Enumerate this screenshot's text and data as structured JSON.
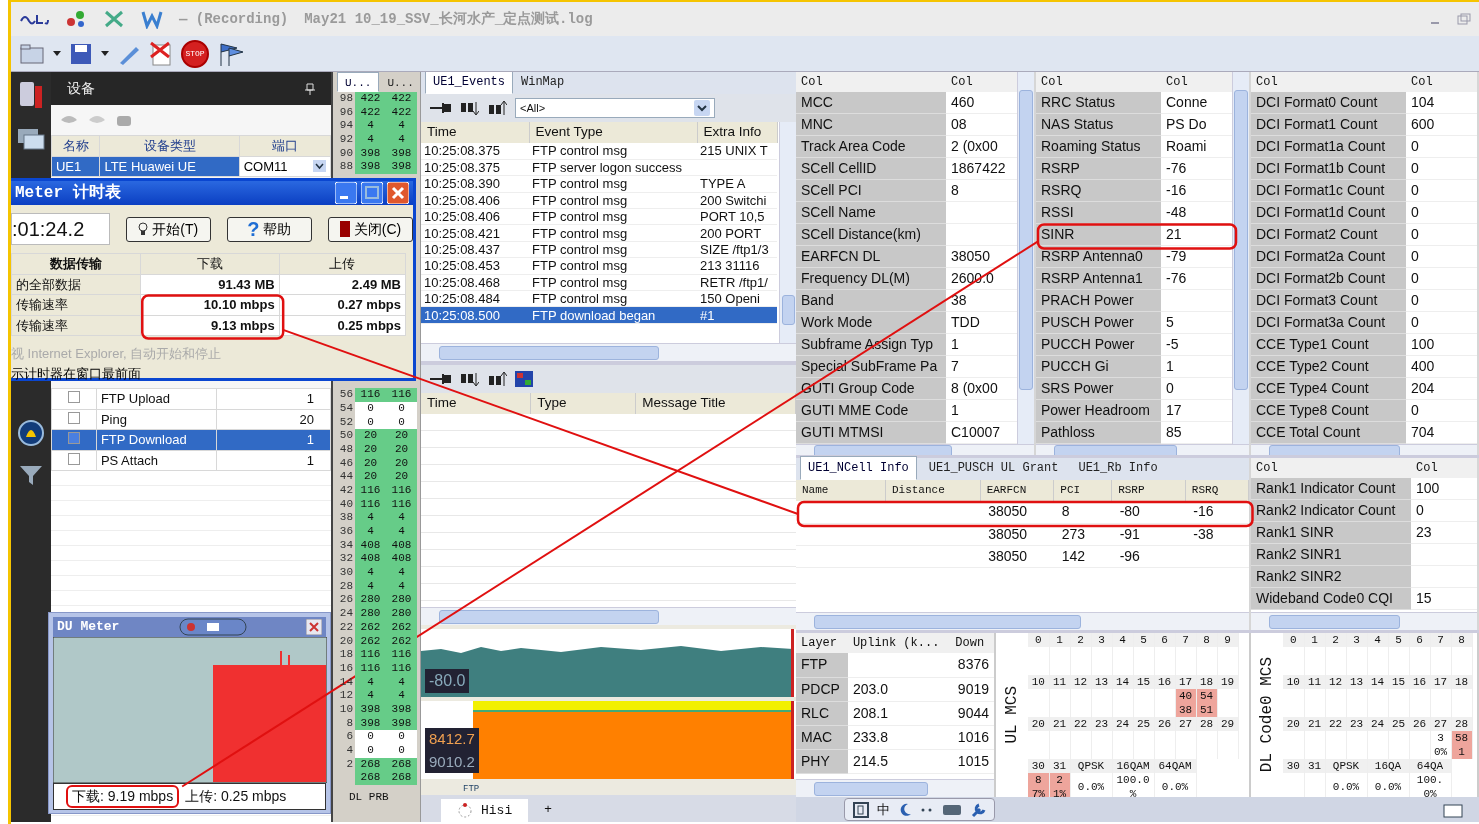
{
  "window": {
    "mode": "— (Recording)",
    "file": "May21 10_19_SSV_长河水产_定点测试.log"
  },
  "toolbar": {
    "stop_label": "STOP"
  },
  "device_panel": {
    "title": "设备",
    "columns": [
      "名称",
      "设备类型",
      "端口"
    ],
    "devices": [
      {
        "name": "UE1",
        "type": "LTE Huawei UE",
        "port": "COM11",
        "selected": true
      }
    ],
    "tasks": [
      {
        "name": "FTP Upload",
        "count": "1",
        "checked": false,
        "selected": false
      },
      {
        "name": "Ping",
        "count": "20",
        "checked": false,
        "selected": false
      },
      {
        "name": "FTP Download",
        "count": "1",
        "checked": false,
        "selected": true
      },
      {
        "name": "PS Attach",
        "count": "1",
        "checked": false,
        "selected": false
      }
    ]
  },
  "du_timer": {
    "title": "Meter 计时表",
    "elapsed": ":01:24.2",
    "buttons": [
      {
        "label": "开始(T)",
        "kind": "start"
      },
      {
        "label": "帮助",
        "kind": "help",
        "icon_text": "?"
      },
      {
        "label": "关闭(C)",
        "kind": "close"
      }
    ],
    "columns": [
      "数据传输",
      "下载",
      "上传"
    ],
    "rows": [
      {
        "label": "的全部数据",
        "download": "91.43 MB",
        "upload": "2.49 MB"
      },
      {
        "label": "传输速率",
        "download": "10.10 mbps",
        "upload": "0.27 mbps"
      },
      {
        "label": "传输速率",
        "download": "9.13 mbps",
        "upload": "0.25 mbps"
      }
    ],
    "options": [
      {
        "label": "视 Internet Explorer, 自动开始和停止",
        "disabled": true
      },
      {
        "label": "示计时器在窗口最前面",
        "disabled": false
      }
    ]
  },
  "du_meter": {
    "title": "DU Meter",
    "download": "下载: 9.19 mbps",
    "upload": "上传: 0.25 mbps"
  },
  "prb": {
    "columns": [
      "U...",
      "U..."
    ],
    "footer": "DL PRB",
    "top_rows": [
      {
        "label": "98",
        "values": [
          "422",
          "422"
        ],
        "shaded": true
      },
      {
        "label": "96",
        "values": [
          "422",
          "422"
        ],
        "shaded": true
      },
      {
        "label": "94",
        "values": [
          "4",
          "4"
        ],
        "shaded": true
      },
      {
        "label": "92",
        "values": [
          "4",
          "4"
        ],
        "shaded": true
      },
      {
        "label": "90",
        "values": [
          "398",
          "398"
        ],
        "shaded": true
      },
      {
        "label": "88",
        "values": [
          "398",
          "398"
        ],
        "shaded": true
      }
    ],
    "bottom_rows": [
      {
        "label": "56",
        "values": [
          "116",
          "116"
        ],
        "shaded": true
      },
      {
        "label": "54",
        "values": [
          "0",
          "0"
        ],
        "shaded": false
      },
      {
        "label": "52",
        "values": [
          "0",
          "0"
        ],
        "shaded": false
      },
      {
        "label": "50",
        "values": [
          "20",
          "20"
        ],
        "shaded": true
      },
      {
        "label": "48",
        "values": [
          "20",
          "20"
        ],
        "shaded": true
      },
      {
        "label": "46",
        "values": [
          "20",
          "20"
        ],
        "shaded": true
      },
      {
        "label": "44",
        "values": [
          "20",
          "20"
        ],
        "shaded": true
      },
      {
        "label": "42",
        "values": [
          "116",
          "116"
        ],
        "shaded": true
      },
      {
        "label": "40",
        "values": [
          "116",
          "116"
        ],
        "shaded": true
      },
      {
        "label": "38",
        "values": [
          "4",
          "4"
        ],
        "shaded": true
      },
      {
        "label": "36",
        "values": [
          "4",
          "4"
        ],
        "shaded": true
      },
      {
        "label": "34",
        "values": [
          "408",
          "408"
        ],
        "shaded": true
      },
      {
        "label": "32",
        "values": [
          "408",
          "408"
        ],
        "shaded": true
      },
      {
        "label": "30",
        "values": [
          "4",
          "4"
        ],
        "shaded": true
      },
      {
        "label": "28",
        "values": [
          "4",
          "4"
        ],
        "shaded": true
      },
      {
        "label": "26",
        "values": [
          "280",
          "280"
        ],
        "shaded": true
      },
      {
        "label": "24",
        "values": [
          "280",
          "280"
        ],
        "shaded": true
      },
      {
        "label": "22",
        "values": [
          "262",
          "262"
        ],
        "shaded": true
      },
      {
        "label": "20",
        "values": [
          "262",
          "262"
        ],
        "shaded": true
      },
      {
        "label": "18",
        "values": [
          "116",
          "116"
        ],
        "shaded": true
      },
      {
        "label": "16",
        "values": [
          "116",
          "116"
        ],
        "shaded": true
      },
      {
        "label": "14",
        "values": [
          "4",
          "4"
        ],
        "shaded": true
      },
      {
        "label": "12",
        "values": [
          "4",
          "4"
        ],
        "shaded": true
      },
      {
        "label": "10",
        "values": [
          "398",
          "398"
        ],
        "shaded": true
      },
      {
        "label": "8",
        "values": [
          "398",
          "398"
        ],
        "shaded": true
      },
      {
        "label": "6",
        "values": [
          "0",
          "0"
        ],
        "shaded": false
      },
      {
        "label": "4",
        "values": [
          "0",
          "0"
        ],
        "shaded": false
      },
      {
        "label": "2",
        "values": [
          "268",
          "268"
        ],
        "shaded": true
      },
      {
        "values": [
          "268",
          "268"
        ],
        "shaded": true
      }
    ]
  },
  "events": {
    "tabs": [
      {
        "label": "UE1_Events",
        "selected": true
      },
      {
        "label": "WinMap",
        "selected": false
      }
    ],
    "filter": "<All>",
    "columns": [
      "Time",
      "Event Type",
      "Extra Info"
    ],
    "rows": [
      {
        "cells": [
          "10:25:08.375",
          "FTP control msg",
          "215 UNIX T"
        ],
        "selected": false
      },
      {
        "cells": [
          "10:25:08.375",
          "FTP server logon success"
        ],
        "selected": false
      },
      {
        "cells": [
          "10:25:08.390",
          "FTP control msg",
          "TYPE A"
        ],
        "selected": false
      },
      {
        "cells": [
          "10:25:08.406",
          "FTP control msg",
          "200 Switchi"
        ],
        "selected": false
      },
      {
        "cells": [
          "10:25:08.406",
          "FTP control msg",
          "PORT 10,5"
        ],
        "selected": false
      },
      {
        "cells": [
          "10:25:08.421",
          "FTP control msg",
          "200 PORT"
        ],
        "selected": false
      },
      {
        "cells": [
          "10:25:08.437",
          "FTP control msg",
          "SIZE /ftp1/3"
        ],
        "selected": false
      },
      {
        "cells": [
          "10:25:08.453",
          "FTP control msg",
          "213 31116"
        ],
        "selected": false
      },
      {
        "cells": [
          "10:25:08.468",
          "FTP control msg",
          "RETR /ftp1/"
        ],
        "selected": false
      },
      {
        "cells": [
          "10:25:08.484",
          "FTP control msg",
          "150 Openi"
        ],
        "selected": false
      },
      {
        "cells": [
          "10:25:08.500",
          "FTP download began",
          "#1"
        ],
        "selected": true
      }
    ]
  },
  "messages": {
    "columns": [
      "Time",
      "Type",
      "Message Title"
    ]
  },
  "strip_charts": {
    "rsrp_reading": "-80.0",
    "throughput_readings": [
      "8412.7",
      "9010.2"
    ],
    "marker": "FTP"
  },
  "bottom_tabs": [
    {
      "label": "Hisi",
      "selected": true
    }
  ],
  "add_tab": "+",
  "info_tables": [
    {
      "columns": [
        "Col",
        "Col"
      ],
      "rows": [
        [
          "MCC",
          "460"
        ],
        [
          "MNC",
          "08"
        ],
        [
          "Track Area Code",
          "2 (0x00"
        ],
        [
          "SCell CellID",
          "1867422"
        ],
        [
          "SCell PCI",
          "8"
        ],
        [
          "SCell Name",
          ""
        ],
        [
          "SCell Distance(km)",
          ""
        ],
        [
          "EARFCN DL",
          "38050"
        ],
        [
          "Frequency DL(M)",
          "2600.0"
        ],
        [
          "Band",
          "38"
        ],
        [
          "Work Mode",
          "TDD"
        ],
        [
          "Subframe Assign Typ",
          "1"
        ],
        [
          "Special SubFrame Pa",
          "7"
        ],
        [
          "GUTI Group Code",
          "8 (0x00"
        ],
        [
          "GUTI MME Code",
          "1"
        ],
        [
          "GUTI MTMSI",
          "C10007"
        ]
      ]
    },
    {
      "columns": [
        "Col",
        "Col"
      ],
      "rows": [
        [
          "RRC Status",
          "Conne"
        ],
        [
          "NAS Status",
          "PS Do"
        ],
        [
          "Roaming Status",
          "Roami"
        ],
        [
          "RSRP",
          "-76"
        ],
        [
          "RSRQ",
          "-16"
        ],
        [
          "RSSI",
          "-48"
        ],
        [
          "SINR",
          "21"
        ],
        [
          "RSRP Antenna0",
          "-79"
        ],
        [
          "RSRP Antenna1",
          "-76"
        ],
        [
          "PRACH Power",
          ""
        ],
        [
          "PUSCH Power",
          "5"
        ],
        [
          "PUCCH Power",
          "-5"
        ],
        [
          "PUCCH Gi",
          "1"
        ],
        [
          "SRS Power",
          "0"
        ],
        [
          "Power Headroom",
          "17"
        ],
        [
          "Pathloss",
          "85"
        ]
      ]
    },
    {
      "columns": [
        "Col",
        "Col"
      ],
      "rows": [
        [
          "DCI Format0 Count",
          "104"
        ],
        [
          "DCI Format1 Count",
          "600"
        ],
        [
          "DCI Format1a Count",
          "0"
        ],
        [
          "DCI Format1b Count",
          "0"
        ],
        [
          "DCI Format1c Count",
          "0"
        ],
        [
          "DCI Format1d Count",
          "0"
        ],
        [
          "DCI Format2 Count",
          "0"
        ],
        [
          "DCI Format2a Count",
          "0"
        ],
        [
          "DCI Format2b Count",
          "0"
        ],
        [
          "DCI Format3 Count",
          "0"
        ],
        [
          "DCI Format3a Count",
          "0"
        ],
        [
          "CCE Type1 Count",
          "100"
        ],
        [
          "CCE Type2 Count",
          "400"
        ],
        [
          "CCE Type4 Count",
          "204"
        ],
        [
          "CCE Type8 Count",
          "0"
        ],
        [
          "CCE Total Count",
          "704"
        ]
      ]
    }
  ],
  "ncell": {
    "tabs": [
      {
        "label": "UE1_NCell Info",
        "selected": true
      },
      {
        "label": "UE1_PUSCH UL Grant",
        "selected": false
      },
      {
        "label": "UE1_Rb Info",
        "selected": false
      }
    ],
    "columns": [
      "Name",
      "Distance",
      "EARFCN",
      "PCI",
      "RSRP",
      "RSRQ"
    ],
    "rows": [
      [
        "",
        "",
        "38050",
        "8",
        "-80",
        "-16"
      ],
      [
        "",
        "",
        "38050",
        "273",
        "-91",
        "-38"
      ],
      [
        "",
        "",
        "38050",
        "142",
        "-96",
        ""
      ]
    ]
  },
  "rank_table": {
    "columns": [
      "Col",
      "Col"
    ],
    "rows": [
      [
        "Rank1 Indicator Count",
        "100"
      ],
      [
        "Rank2 Indicator Count",
        "0"
      ],
      [
        "Rank1 SINR",
        "23"
      ],
      [
        "Rank2 SINR1",
        ""
      ],
      [
        "Rank2 SINR2",
        ""
      ],
      [
        "Wideband Code0 CQI",
        "15"
      ]
    ]
  },
  "layer_table": {
    "columns": [
      "Layer",
      "Uplink (k...",
      "Down"
    ],
    "rows": [
      [
        "FTP",
        "",
        "8376"
      ],
      [
        "PDCP",
        "203.0",
        "9019"
      ],
      [
        "RLC",
        "208.1",
        "9044"
      ],
      [
        "MAC",
        "233.8",
        "1016"
      ],
      [
        "PHY",
        "214.5",
        "1015"
      ]
    ]
  },
  "mcs_grids": [
    {
      "label": "UL MCS",
      "rows": [
        {
          "kind": "mcs",
          "headers": [
            "0",
            "1",
            "2",
            "3",
            "4",
            "5",
            "6",
            "7",
            "8",
            "9"
          ]
        },
        {
          "kind": "mcs",
          "headers": [
            "10",
            "11",
            "12",
            "13",
            "14",
            "15",
            "16",
            "17",
            "18",
            "19"
          ],
          "cells": [
            "",
            "",
            "",
            "",
            "",
            "",
            "",
            {
              "values": [
                "40",
                "38"
              ],
              "hot": true
            },
            {
              "values": [
                "54",
                "51"
              ],
              "hot": true
            },
            ""
          ]
        },
        {
          "kind": "mcs",
          "headers": [
            "20",
            "21",
            "22",
            "23",
            "24",
            "25",
            "26",
            "27",
            "28",
            "29"
          ]
        },
        {
          "kind": "summary",
          "headers": [
            "30",
            "31",
            "QPSK",
            "16QAM",
            "64QAM"
          ],
          "cells": [
            {
              "values": [
                "8",
                "7%"
              ],
              "hot": true
            },
            {
              "values": [
                "2",
                "1%"
              ],
              "hot": true
            },
            {
              "values": [
                "0.0%"
              ],
              "hot": false
            },
            {
              "values": [
                "100.0",
                "%"
              ],
              "hot": false
            },
            {
              "values": [
                "0.0%"
              ],
              "hot": false
            }
          ]
        }
      ]
    },
    {
      "label": "DL Code0 MCS",
      "rows": [
        {
          "kind": "mcs",
          "headers": [
            "0",
            "1",
            "2",
            "3",
            "4",
            "5",
            "6",
            "7",
            "8"
          ]
        },
        {
          "kind": "mcs",
          "headers": [
            "10",
            "11",
            "12",
            "13",
            "14",
            "15",
            "16",
            "17",
            "18"
          ]
        },
        {
          "kind": "mcs",
          "headers": [
            "20",
            "21",
            "22",
            "23",
            "24",
            "25",
            "26",
            "27",
            "28"
          ],
          "cells": [
            "",
            "",
            "",
            "",
            "",
            "",
            "",
            {
              "values": [
                "3",
                "0%"
              ],
              "hot": false
            },
            {
              "values": [
                "58",
                "1"
              ],
              "hot": true
            }
          ]
        },
        {
          "kind": "summary",
          "headers": [
            "30",
            "31",
            "QPSK",
            "16QA",
            "64QA"
          ],
          "cells": [
            "",
            "",
            {
              "values": [
                "0.0%"
              ],
              "hot": false
            },
            {
              "values": [
                "0.0%"
              ],
              "hot": false
            },
            {
              "values": [
                "100.",
                "0%"
              ],
              "hot": false
            }
          ]
        }
      ]
    }
  ],
  "ime_bar": {
    "mode": "中"
  }
}
